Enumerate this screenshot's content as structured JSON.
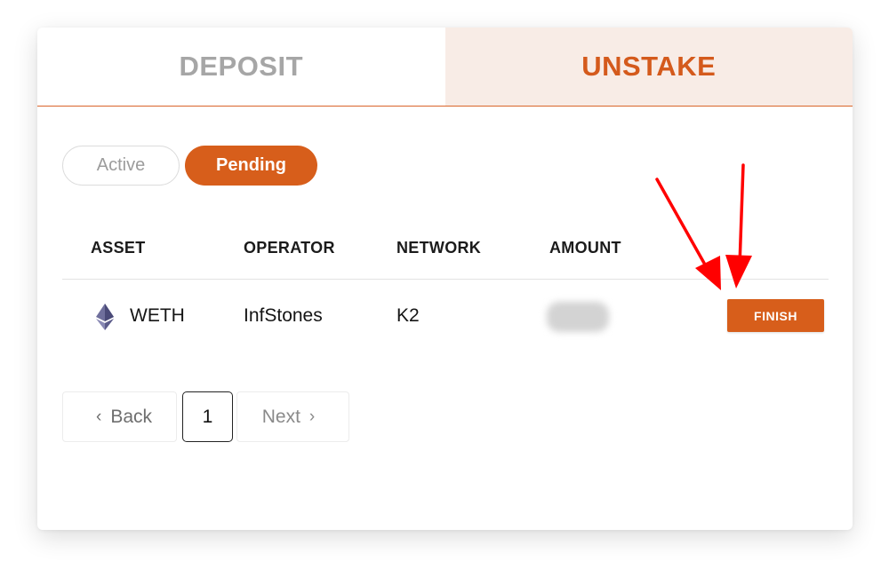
{
  "tabs": [
    {
      "label": "DEPOSIT",
      "selected": false
    },
    {
      "label": "UNSTAKE",
      "selected": true
    }
  ],
  "filters": {
    "active_label": "Active",
    "pending_label": "Pending",
    "selected": "Pending"
  },
  "table": {
    "headers": [
      "ASSET",
      "OPERATOR",
      "NETWORK",
      "AMOUNT"
    ],
    "rows": [
      {
        "asset_icon": "ethereum-icon",
        "asset": "WETH",
        "operator": "InfStones",
        "network": "K2",
        "action_label": "FINISH"
      }
    ]
  },
  "pagination": {
    "back_label": "Back",
    "current_page": "1",
    "next_label": "Next"
  },
  "colors": {
    "accent": "#d75e1b",
    "accent_tab_bg": "#f8ece6",
    "annotation_arrow": "#ff0000"
  }
}
